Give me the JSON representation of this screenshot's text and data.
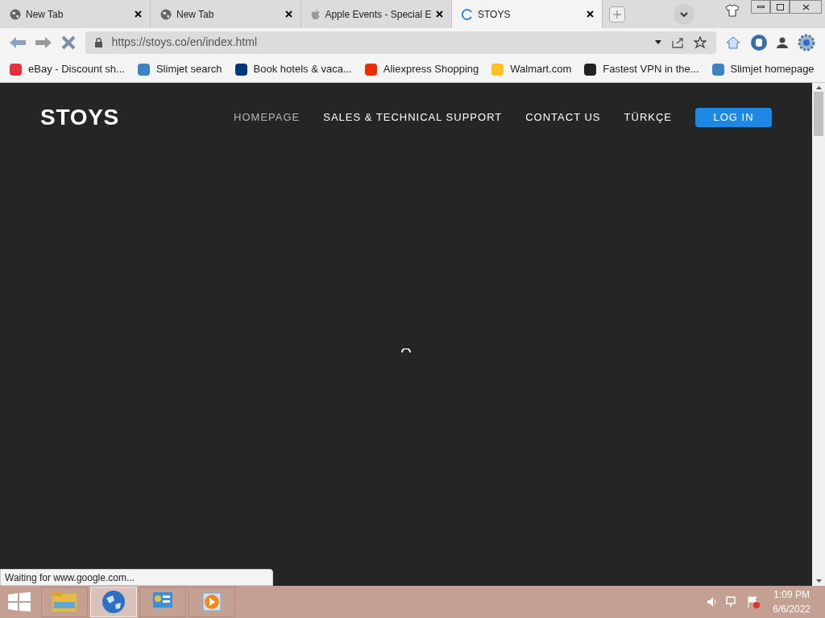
{
  "tabs": [
    {
      "title": "New Tab",
      "kind": "globe",
      "selected": false
    },
    {
      "title": "New Tab",
      "kind": "globe",
      "selected": false
    },
    {
      "title": "Apple Events - Special E",
      "kind": "apple",
      "selected": false
    },
    {
      "title": "STOYS",
      "kind": "loading",
      "selected": true
    }
  ],
  "address_bar": {
    "url": "https://stoys.co/en/index.html"
  },
  "bookmarks": [
    {
      "label": "eBay - Discount sh...",
      "color": "#e53238"
    },
    {
      "label": "Slimjet search",
      "color": "#3b82c4"
    },
    {
      "label": "Book hotels & vaca...",
      "color": "#003580"
    },
    {
      "label": "Aliexpress Shopping",
      "color": "#e62e04"
    },
    {
      "label": "Walmart.com",
      "color": "#ffc220"
    },
    {
      "label": "Fastest VPN in the...",
      "color": "#222222"
    },
    {
      "label": "Slimjet homepage",
      "color": "#3b82c4"
    }
  ],
  "site": {
    "logo": "STOYS",
    "nav": [
      {
        "label": "HOMEPAGE",
        "selected": true
      },
      {
        "label": "SALES & TECHNICAL SUPPORT",
        "selected": false
      },
      {
        "label": "CONTACT US",
        "selected": false
      },
      {
        "label": "TÜRKÇE",
        "selected": false
      }
    ],
    "login": "LOG IN"
  },
  "status_bar": "Waiting for www.google.com...",
  "taskbar": {
    "apps": [
      {
        "kind": "folder",
        "selected": false
      },
      {
        "kind": "globe",
        "selected": true
      },
      {
        "kind": "panel",
        "selected": false
      },
      {
        "kind": "player",
        "selected": false
      }
    ],
    "time": "1:09 PM",
    "date": "6/6/2022"
  }
}
